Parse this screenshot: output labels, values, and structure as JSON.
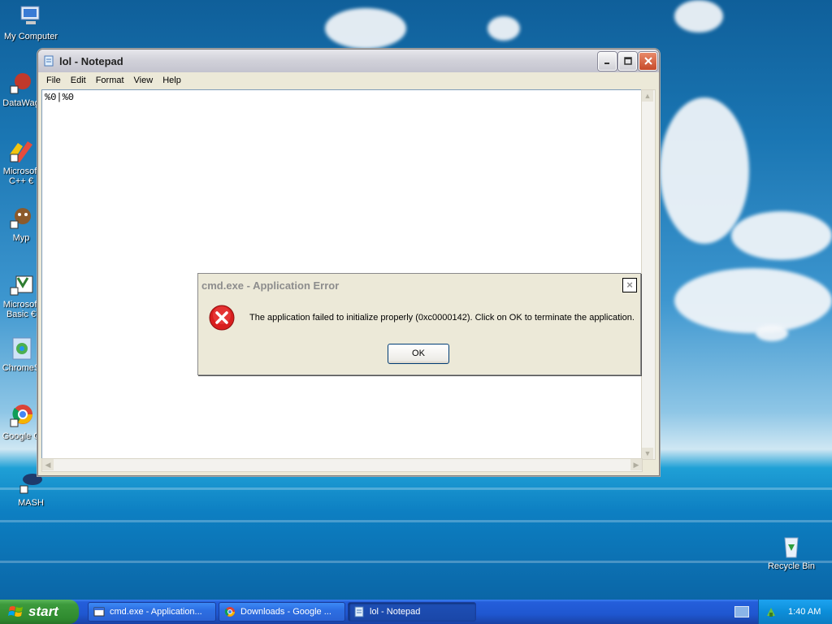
{
  "desktop": {
    "icons": [
      {
        "label": "My Computer",
        "icon": "my-computer-icon"
      },
      {
        "label": "DataWag",
        "icon": "datawag-icon"
      },
      {
        "label": "Microsoft\nC++ €",
        "icon": "visual-cpp-icon"
      },
      {
        "label": "Myp",
        "icon": "myp-icon"
      },
      {
        "label": "Microsoft\nBasic €",
        "icon": "visual-basic-icon"
      },
      {
        "label": "ChromeS",
        "icon": "chrome-setup-icon"
      },
      {
        "label": "Google C",
        "icon": "google-chrome-icon"
      },
      {
        "label": "MASH",
        "icon": "mash-icon"
      },
      {
        "label": "Recycle Bin",
        "icon": "recycle-bin-icon"
      }
    ]
  },
  "notepad": {
    "title": "lol - Notepad",
    "menu": [
      "File",
      "Edit",
      "Format",
      "View",
      "Help"
    ],
    "content": "%0|%0"
  },
  "error_dialog": {
    "title": "cmd.exe - Application Error",
    "message": "The application failed to initialize properly (0xc0000142). Click on OK to terminate the application.",
    "ok_label": "OK",
    "close_label": "×"
  },
  "taskbar": {
    "start_label": "start",
    "tasks": [
      {
        "label": "cmd.exe - Application...",
        "icon": "cmd-window-icon"
      },
      {
        "label": "Downloads - Google ...",
        "icon": "chrome-icon"
      },
      {
        "label": "lol - Notepad",
        "icon": "notepad-icon"
      }
    ],
    "clock": "1:40 AM"
  },
  "colors": {
    "taskbar": "#245edb",
    "start": "#3c9a3c",
    "error_red": "#d81e1e"
  }
}
